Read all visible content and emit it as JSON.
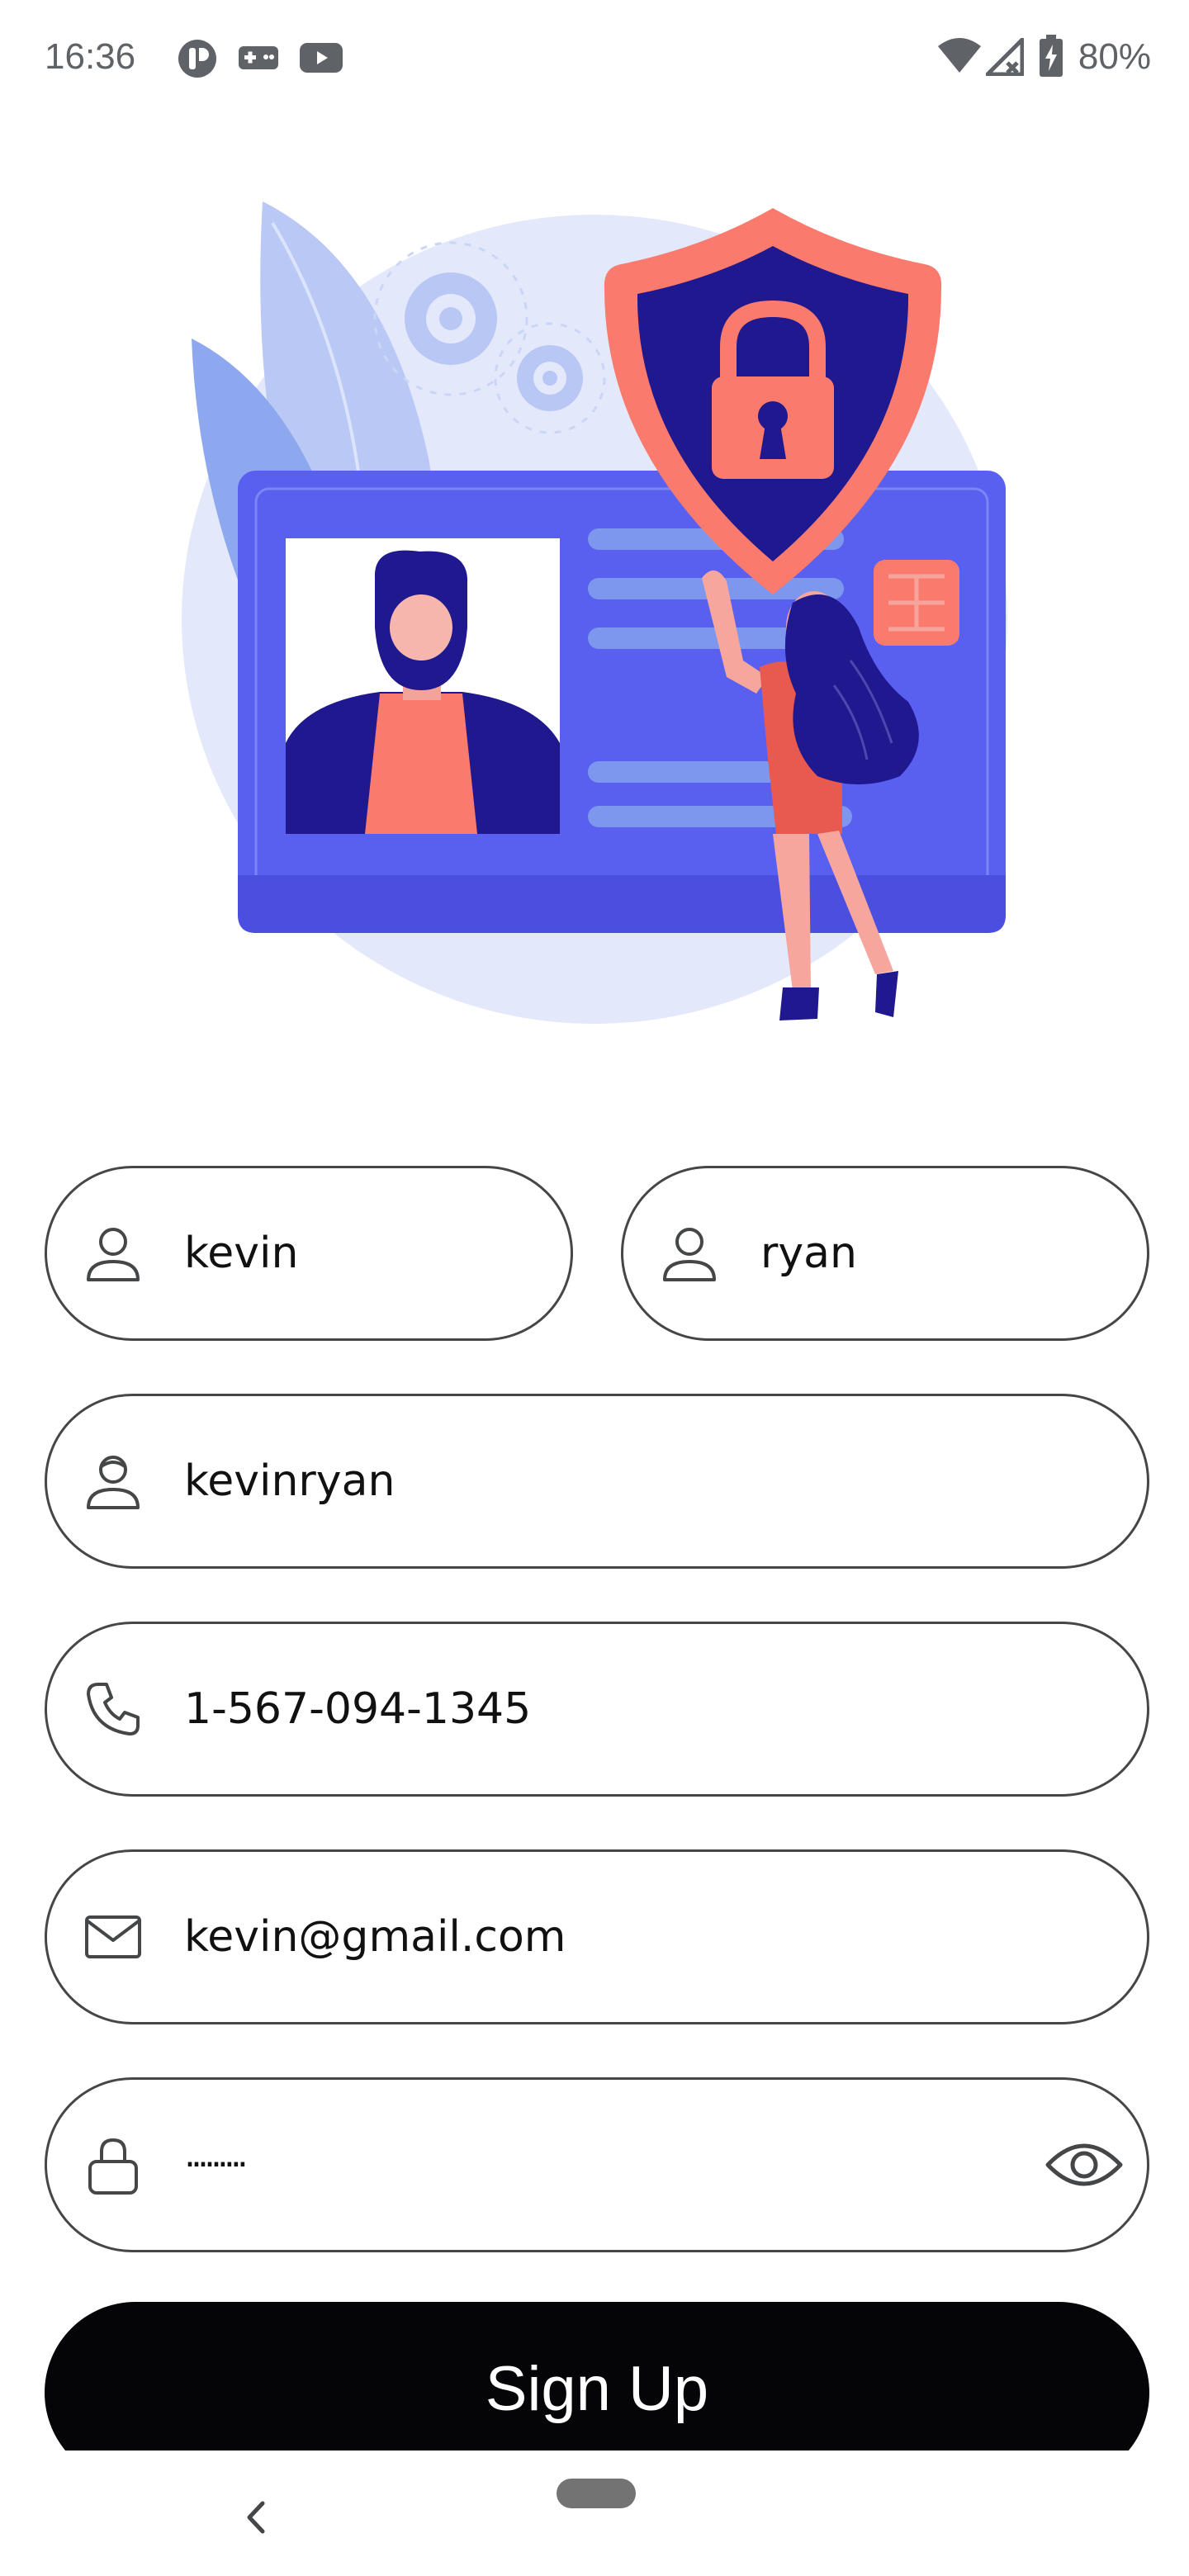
{
  "status_bar": {
    "time": "16:36",
    "battery": "80%",
    "icons": [
      "app-notification-icon",
      "gamepad-icon",
      "youtube-icon",
      "wifi-icon",
      "no-signal-icon",
      "battery-charging-icon"
    ]
  },
  "illustration": {
    "description_icon": "id-card-security-illustration"
  },
  "form": {
    "first_name": {
      "value": "kevin",
      "icon": "user-icon"
    },
    "last_name": {
      "value": "ryan",
      "icon": "user-icon"
    },
    "username": {
      "value": "kevinryan",
      "icon": "user-badge-icon"
    },
    "phone": {
      "value": "1-567-094-1345",
      "icon": "phone-icon"
    },
    "email": {
      "value": "kevin@gmail.com",
      "icon": "mail-icon"
    },
    "password": {
      "value": "·········",
      "icon": "lock-icon",
      "toggle_icon": "eye-icon"
    }
  },
  "signup_button": {
    "label": "Sign Up"
  },
  "colors": {
    "border": "#444648",
    "button_bg": "#050508",
    "button_text": "#ffffff",
    "card_blue": "#5960f0",
    "shield_coral": "#fa7b6e",
    "navy": "#1c1680"
  }
}
